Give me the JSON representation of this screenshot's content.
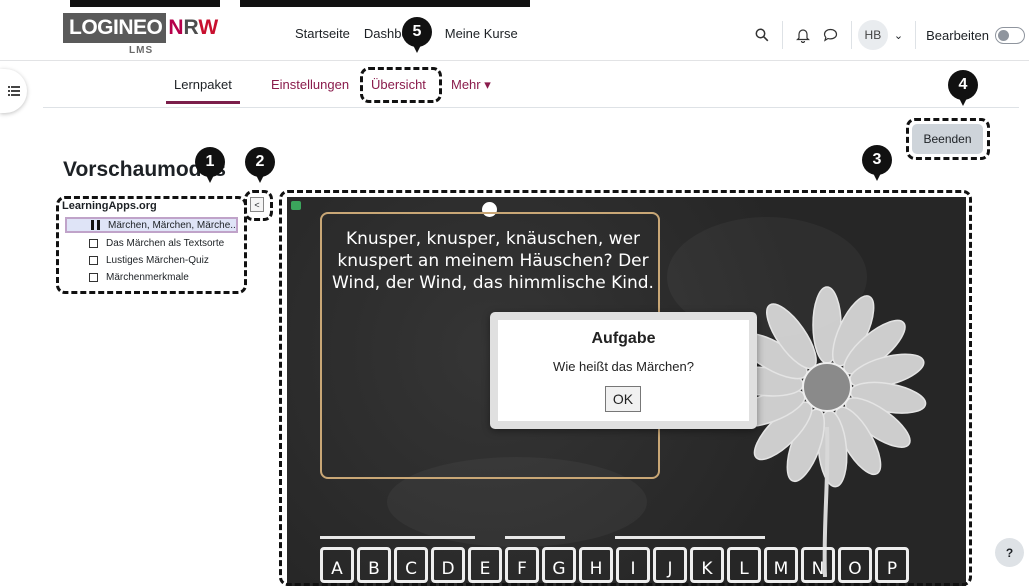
{
  "brand": {
    "logo_main": "LOGINEO",
    "logo_n": "N",
    "logo_r": "R",
    "logo_w": "W",
    "logo_sub": "LMS"
  },
  "primary_nav": {
    "home": "Startseite",
    "dashboard": "Dashbo",
    "courses": "Meine Kurse"
  },
  "user": {
    "initials": "HB",
    "edit_label": "Bearbeiten"
  },
  "icons": {
    "search": "search-icon",
    "bell": "bell-icon",
    "chat": "chat-icon",
    "drawer": "list-icon"
  },
  "secondary_nav": {
    "lernpaket": "Lernpaket",
    "einstellungen": "Einstellungen",
    "uebersicht": "Übersicht",
    "mehr": "Mehr ▾"
  },
  "finish_button": "Beenden",
  "page_title": "Vorschaumodus",
  "toc": {
    "title": "LearningApps.org",
    "collapse": "<",
    "items": [
      {
        "label": "Märchen, Märchen, Märche...",
        "state": "playing"
      },
      {
        "label": "Das Märchen als Textsorte",
        "state": "unchecked"
      },
      {
        "label": "Lustiges Märchen-Quiz",
        "state": "unchecked"
      },
      {
        "label": "Märchenmerkmale",
        "state": "unchecked"
      }
    ]
  },
  "activity": {
    "riddle": "Knusper, knusper, knäuschen, wer knuspert an meinem Häuschen? Der Wind, der Wind, das himmlische Kind.",
    "letters": [
      "A",
      "B",
      "C",
      "D",
      "E",
      "F",
      "G",
      "H",
      "I",
      "J",
      "K",
      "L",
      "M",
      "N",
      "O",
      "P"
    ]
  },
  "modal": {
    "title": "Aufgabe",
    "message": "Wie heißt das Märchen?",
    "ok": "OK"
  },
  "callouts": [
    "1",
    "2",
    "3",
    "4",
    "5"
  ],
  "help": "?"
}
